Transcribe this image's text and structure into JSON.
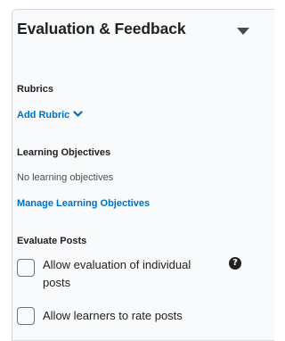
{
  "panel": {
    "title": "Evaluation & Feedback",
    "collapse_icon": "caret-down-icon"
  },
  "rubrics": {
    "label": "Rubrics",
    "add_link": "Add Rubric",
    "add_link_icon": "chevron-down-icon"
  },
  "learning_objectives": {
    "label": "Learning Objectives",
    "empty_text": "No learning objectives",
    "manage_link": "Manage Learning Objectives"
  },
  "evaluate_posts": {
    "label": "Evaluate Posts",
    "options": [
      {
        "label_line1": "Allow evaluation of individual",
        "label_line2": "posts",
        "checked": false,
        "help_icon": "question-circle-icon"
      },
      {
        "label": "Allow learners to rate posts",
        "checked": false
      }
    ]
  },
  "colors": {
    "link": "#006fbf",
    "text": "#202122",
    "panel_bg": "#f9fafb",
    "border": "#d3d9e3"
  }
}
